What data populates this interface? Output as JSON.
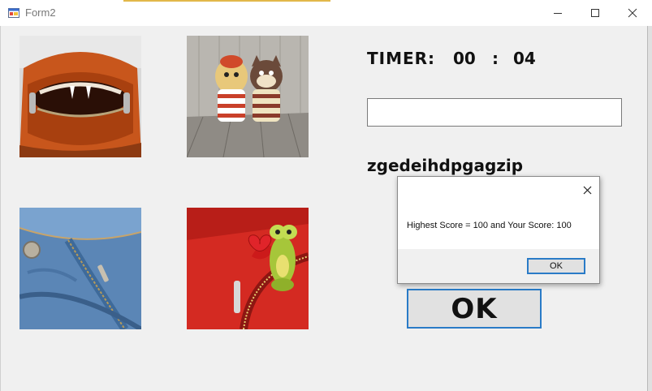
{
  "window": {
    "title": "Form2",
    "minimize_icon": "minimize-icon",
    "maximize_icon": "maximize-icon",
    "close_icon": "close-icon"
  },
  "images": [
    {
      "name": "orange-bag-zipper-mouth"
    },
    {
      "name": "striped-toy-dolls"
    },
    {
      "name": "jeans-zipper"
    },
    {
      "name": "frog-toy-red-zipper"
    }
  ],
  "timer": {
    "label": "TIMER:",
    "minutes": "00",
    "separator": ":",
    "seconds": "04"
  },
  "answer_input": {
    "value": ""
  },
  "scrambled_word": "zgedeihdpgagzip",
  "ok_button": "OK",
  "message_box": {
    "text": "Highest Score = 100 and Your Score: 100",
    "ok_label": "OK",
    "close_icon": "close-icon"
  },
  "colors": {
    "accent": "#2a7bc7",
    "background": "#f0f0f0"
  }
}
